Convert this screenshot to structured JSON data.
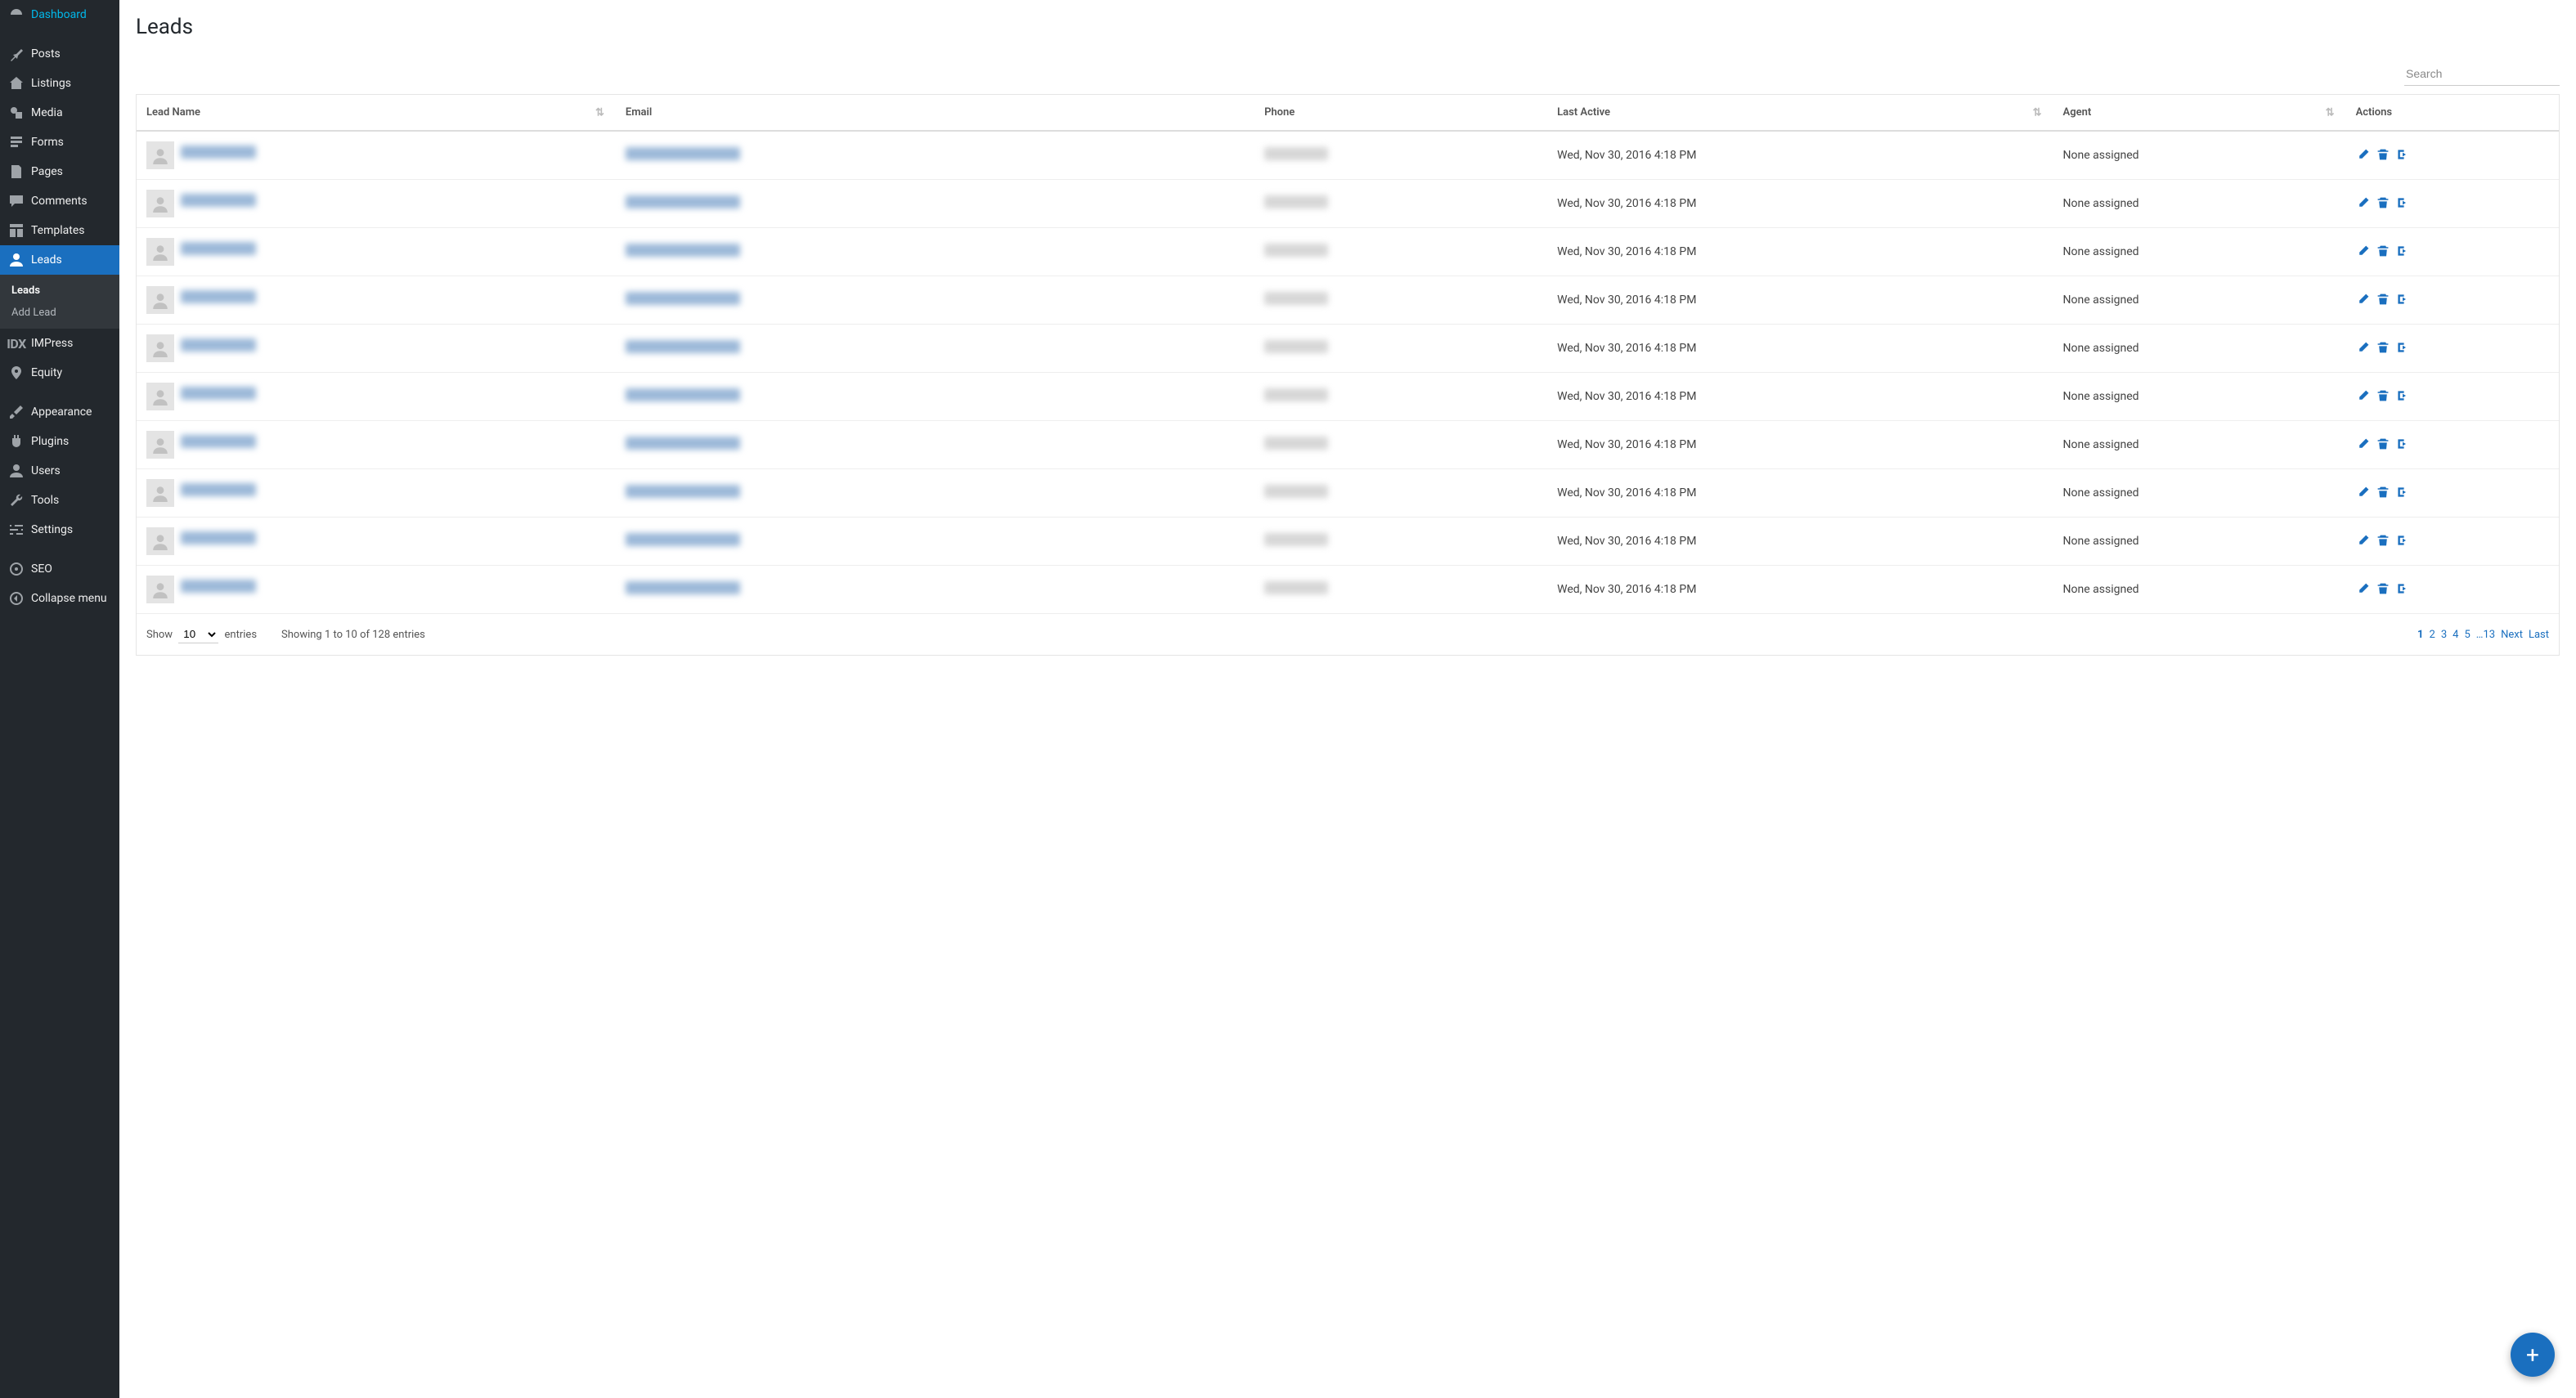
{
  "sidebar": {
    "items": [
      {
        "label": "Dashboard"
      },
      {
        "label": "Posts"
      },
      {
        "label": "Listings"
      },
      {
        "label": "Media"
      },
      {
        "label": "Forms"
      },
      {
        "label": "Pages"
      },
      {
        "label": "Comments"
      },
      {
        "label": "Templates"
      },
      {
        "label": "Leads"
      },
      {
        "label": "IMPress"
      },
      {
        "label": "Equity"
      },
      {
        "label": "Appearance"
      },
      {
        "label": "Plugins"
      },
      {
        "label": "Users"
      },
      {
        "label": "Tools"
      },
      {
        "label": "Settings"
      },
      {
        "label": "SEO"
      },
      {
        "label": "Collapse menu"
      }
    ],
    "leads_sub": [
      {
        "label": "Leads"
      },
      {
        "label": "Add Lead"
      }
    ]
  },
  "page": {
    "title": "Leads"
  },
  "search": {
    "placeholder": "Search"
  },
  "table": {
    "columns": {
      "lead_name": "Lead Name",
      "email": "Email",
      "phone": "Phone",
      "last_active": "Last Active",
      "agent": "Agent",
      "actions": "Actions"
    },
    "rows": [
      {
        "last_active": "Wed, Nov 30, 2016 4:18 PM",
        "agent": "None assigned"
      },
      {
        "last_active": "Wed, Nov 30, 2016 4:18 PM",
        "agent": "None assigned"
      },
      {
        "last_active": "Wed, Nov 30, 2016 4:18 PM",
        "agent": "None assigned"
      },
      {
        "last_active": "Wed, Nov 30, 2016 4:18 PM",
        "agent": "None assigned"
      },
      {
        "last_active": "Wed, Nov 30, 2016 4:18 PM",
        "agent": "None assigned"
      },
      {
        "last_active": "Wed, Nov 30, 2016 4:18 PM",
        "agent": "None assigned"
      },
      {
        "last_active": "Wed, Nov 30, 2016 4:18 PM",
        "agent": "None assigned"
      },
      {
        "last_active": "Wed, Nov 30, 2016 4:18 PM",
        "agent": "None assigned"
      },
      {
        "last_active": "Wed, Nov 30, 2016 4:18 PM",
        "agent": "None assigned"
      },
      {
        "last_active": "Wed, Nov 30, 2016 4:18 PM",
        "agent": "None assigned"
      }
    ],
    "footer": {
      "show_label_pre": "Show",
      "show_value": "10",
      "show_label_post": "entries",
      "info": "Showing 1 to 10 of 128 entries",
      "pages": [
        "1",
        "2",
        "3",
        "4",
        "5",
        "…13",
        "Next",
        "Last"
      ]
    }
  },
  "fab": {
    "label": "+"
  }
}
